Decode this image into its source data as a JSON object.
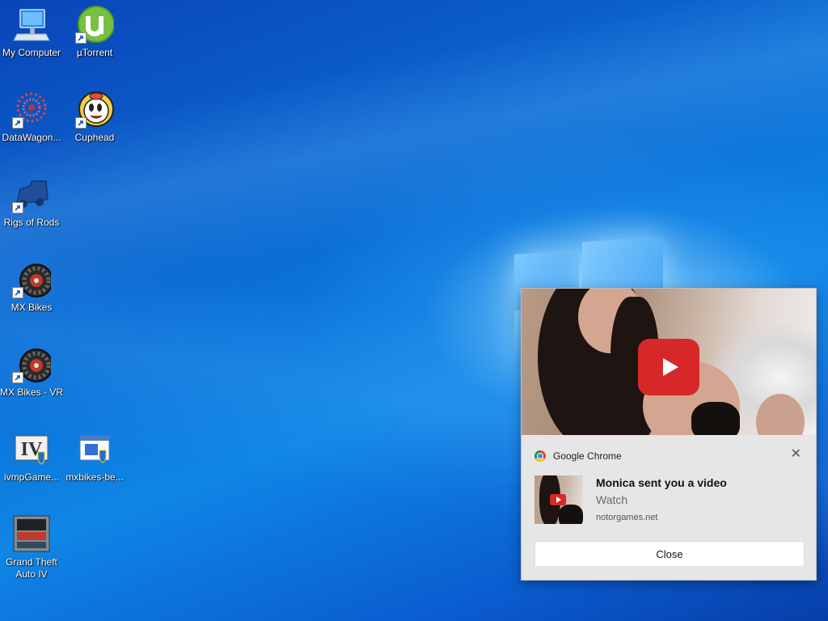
{
  "desktop": {
    "icons": [
      {
        "label": "My Computer",
        "icon": "computer-icon"
      },
      {
        "label": "µTorrent",
        "icon": "utorrent-icon"
      },
      {
        "label": "DataWagon...",
        "icon": "datawagon-icon"
      },
      {
        "label": "Cuphead",
        "icon": "cuphead-icon"
      },
      {
        "label": "Rigs of Rods",
        "icon": "rigs-of-rods-icon"
      },
      {
        "label": "MX Bikes",
        "icon": "dirt-bike-wheel-icon"
      },
      {
        "label": "MX Bikes - VR",
        "icon": "dirt-bike-wheel-icon"
      },
      {
        "label": "ivmpGame...",
        "icon": "gta-iv-shield-icon"
      },
      {
        "label": "mxbikes-be...",
        "icon": "installer-shield-icon"
      },
      {
        "label": "Grand Theft Auto IV",
        "icon": "gta-iv-icon"
      }
    ]
  },
  "notification": {
    "app_name": "Google Chrome",
    "title": "Monica sent you a video",
    "body": "Watch",
    "attribution": "notorgames.net",
    "close_button": "Close",
    "dismiss_glyph": "✕",
    "accent_color": "#d62828"
  },
  "colors": {
    "wallpaper_primary": "#0b6fd6",
    "toast_background": "#e6e6e6"
  }
}
